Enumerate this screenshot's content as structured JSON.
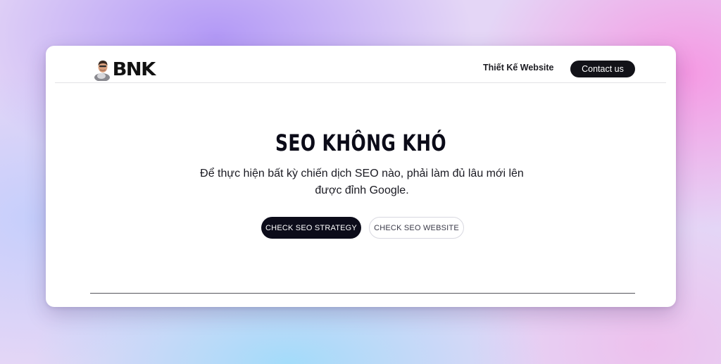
{
  "header": {
    "logo_text": "BNK",
    "nav_link_label": "Thiết Kế Website",
    "contact_label": "Contact us"
  },
  "hero": {
    "title": "SEO KHÔNG KHÓ",
    "subtitle": "Để thực hiện bất kỳ chiến dịch SEO nào, phải làm đủ lâu mới lên được đỉnh Google.",
    "primary_button_label": "CHECK SEO STRATEGY",
    "secondary_button_label": "CHECK SEO WEBSITE"
  },
  "colors": {
    "dark": "#0c0c1a",
    "background_gradient": [
      "#b096f6",
      "#f696e2",
      "#a0dcfa"
    ]
  },
  "icons": {
    "avatar": "person-avatar-icon"
  }
}
